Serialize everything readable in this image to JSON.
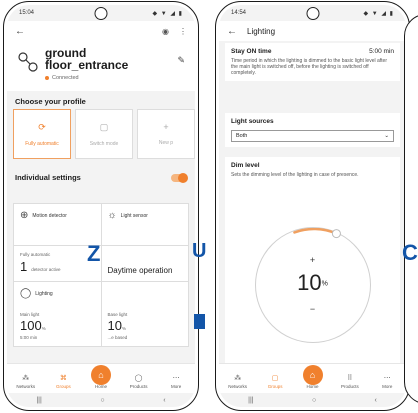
{
  "left": {
    "status_time": "15:04",
    "status_icons": "▲ ◼ ⚙",
    "status_right": "◆ ▼ ◢ ▮",
    "room_name_line1": "ground",
    "room_name_line2": "floor_entrance",
    "connection": "Connected",
    "choose_profile": "Choose your profile",
    "profiles": [
      {
        "label": "Fully automatic",
        "icon": "automatic-icon",
        "glyph": "⟳",
        "active": true
      },
      {
        "label": "Switch mode",
        "icon": "switch-icon",
        "glyph": "▢",
        "active": false
      },
      {
        "label": "New p",
        "icon": "plus-icon",
        "glyph": "+",
        "active": false
      }
    ],
    "individual_settings": "Individual settings",
    "motion_detector": "Motion detector",
    "light_sensor": "Light sensor",
    "fully_automatic_small": "Fully automatic",
    "detector_count": "1",
    "detector_active": "detector active",
    "daytime_operation": "Daytime operation",
    "lighting": "Lighting",
    "main_light": "Main light",
    "main_light_value": "100",
    "main_light_unit": "%",
    "main_light_time": "5:00 min",
    "base_light": "Base light",
    "base_light_value": "10",
    "base_light_unit": "%",
    "base_light_note": "...e based",
    "nav": [
      {
        "label": "Networks",
        "icon": "networks-icon",
        "glyph": "⁂",
        "active": false
      },
      {
        "label": "Groups",
        "icon": "groups-icon",
        "glyph": "⌘",
        "active": true
      },
      {
        "label": "Home",
        "icon": "home-icon",
        "glyph": "",
        "active": false
      },
      {
        "label": "Products",
        "icon": "products-icon",
        "glyph": "◯",
        "active": false
      },
      {
        "label": "More",
        "icon": "more-icon",
        "glyph": "⋯",
        "active": false
      }
    ]
  },
  "right": {
    "status_time": "14:54",
    "status_icons": "◼ ▣",
    "status_right": "◆ ▼ ◢ ▮",
    "title": "Lighting",
    "stay_on_time_label": "Stay ON time",
    "stay_on_time_value": "5:00 min",
    "stay_on_desc": "Time period in which the lighting is dimmed to the basic light level after the main light is switched off, before the lighting is switched off completely.",
    "light_sources_label": "Light sources",
    "light_sources_value": "Both",
    "dim_level_label": "Dim level",
    "dim_level_desc": "Sets the dimming level of the lighting in case of presence.",
    "dim_value": "10",
    "dim_unit": "%",
    "dim_percent": 0.1,
    "nav": [
      {
        "label": "Networks",
        "icon": "networks-icon",
        "glyph": "⁂",
        "active": false
      },
      {
        "label": "Groups",
        "icon": "groups-icon",
        "glyph": "▢",
        "active": true
      },
      {
        "label": "Home",
        "icon": "home-icon",
        "glyph": "",
        "active": false
      },
      {
        "label": "Products",
        "icon": "products-icon",
        "glyph": "⠿",
        "active": false
      },
      {
        "label": "More",
        "icon": "more-icon",
        "glyph": "⋯",
        "active": false
      }
    ]
  },
  "watermark": {
    "z": "Z",
    "u": "U",
    "c": "C"
  },
  "colors": {
    "accent": "#f0802d",
    "watermark": "#1355a8"
  }
}
